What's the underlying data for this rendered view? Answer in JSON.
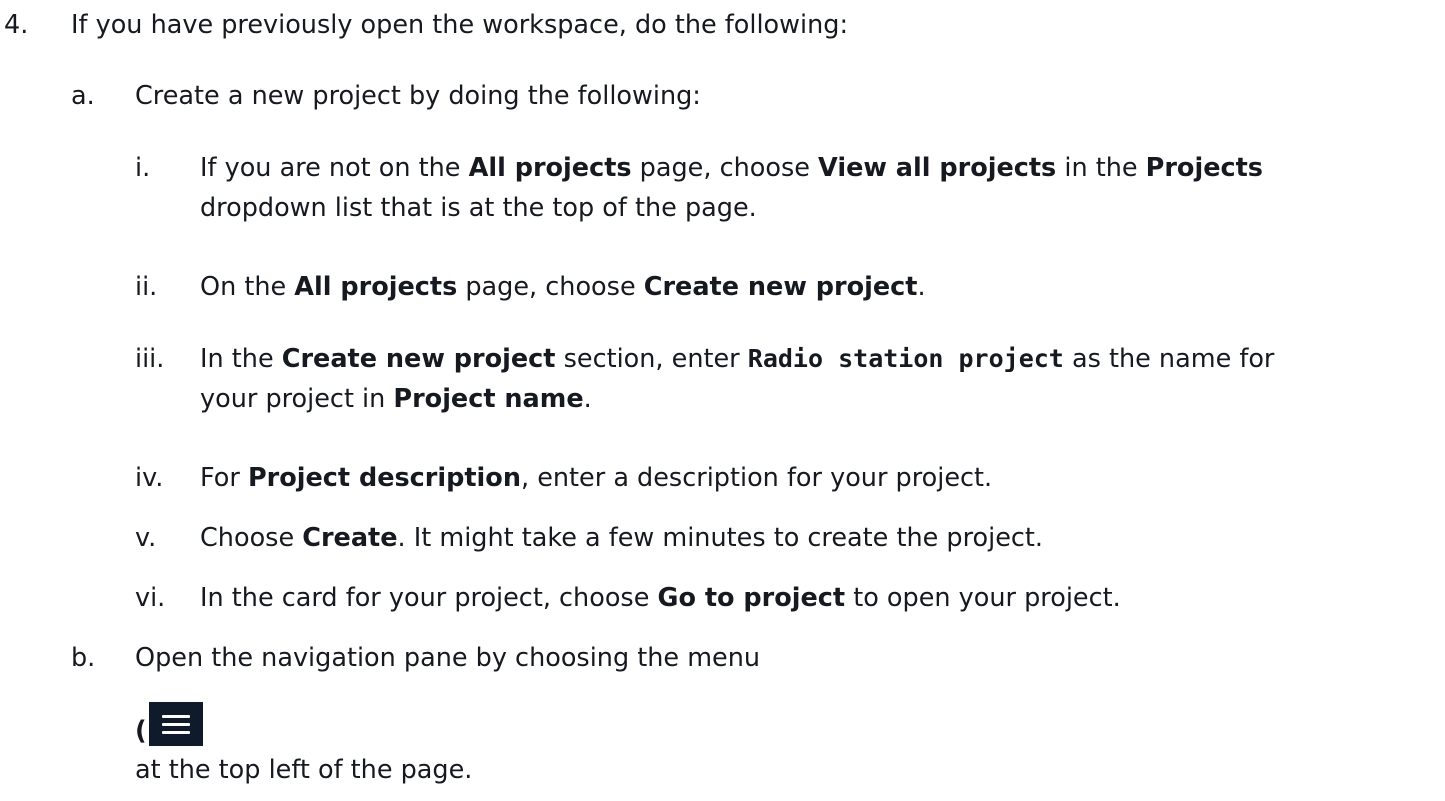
{
  "step4": {
    "num": "4.",
    "text": "If you have previously open the workspace, do the following:"
  },
  "a": {
    "num": "a.",
    "text": "Create a new project by doing the following:"
  },
  "i": {
    "num": "i.",
    "t1": "If you are not on the ",
    "b1": "All projects",
    "t2": " page, choose ",
    "b2": "View all projects",
    "t3": " in the ",
    "b3": "Projects",
    "line2": "dropdown list that is at the top of the page."
  },
  "ii": {
    "num": "ii.",
    "t1": "On the ",
    "b1": "All projects",
    "t2": " page, choose ",
    "b2": "Create new project",
    "t3": "."
  },
  "iii": {
    "num": "iii.",
    "t1": "In the ",
    "b1": "Create new project",
    "t2": " section, enter ",
    "code": "Radio station project",
    "t3": " as the name for",
    "line2_t1": "your project in ",
    "line2_b1": "Project name",
    "line2_t2": "."
  },
  "iv": {
    "num": "iv.",
    "t1": "For ",
    "b1": "Project description",
    "t2": ", enter a description for your project."
  },
  "v": {
    "num": "v.",
    "t1": "Choose ",
    "b1": "Create",
    "t2": ". It might take a few minutes to create the project."
  },
  "vi": {
    "num": "vi.",
    "t1": "In the card for your project, choose ",
    "b1": "Go to project",
    "t2": " to open your project."
  },
  "b": {
    "num": "b.",
    "text": "Open the navigation pane by choosing the menu",
    "paren": "(",
    "after": "at the top left of the page."
  },
  "icons": {
    "menu": "hamburger-menu-icon"
  }
}
